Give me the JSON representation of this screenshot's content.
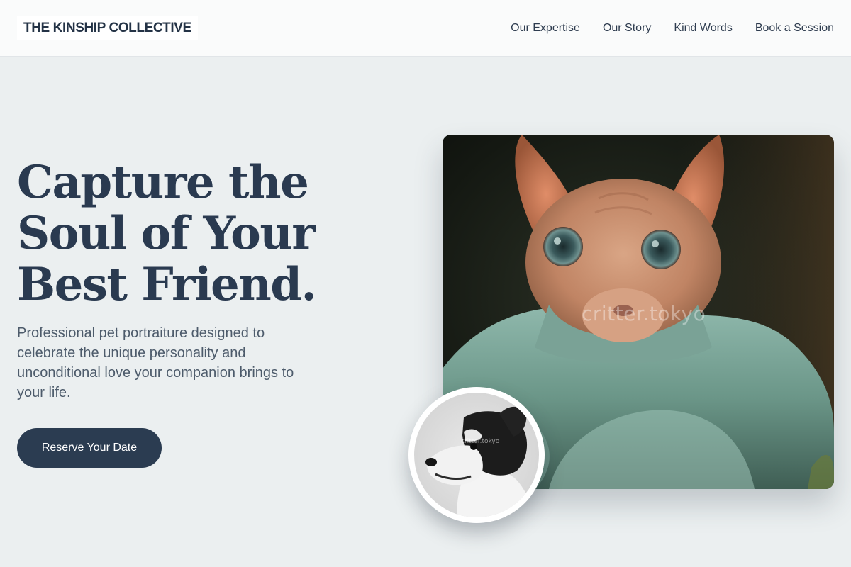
{
  "brand": {
    "name": "THE KINSHIP COLLECTIVE"
  },
  "nav": {
    "items": [
      {
        "label": "Our Expertise"
      },
      {
        "label": "Our Story"
      },
      {
        "label": "Kind Words"
      },
      {
        "label": "Book a Session"
      }
    ]
  },
  "hero": {
    "title_lines": [
      "Capture the",
      "Soul of Your",
      "Best Friend."
    ],
    "subtitle": "Professional pet portraiture designed to celebrate the unique personality and unconditional love your companion brings to your life.",
    "cta_label": "Reserve Your Date"
  },
  "images": {
    "main_watermark": "critter.tokyo",
    "avatar_watermark": "critter.tokyo"
  }
}
